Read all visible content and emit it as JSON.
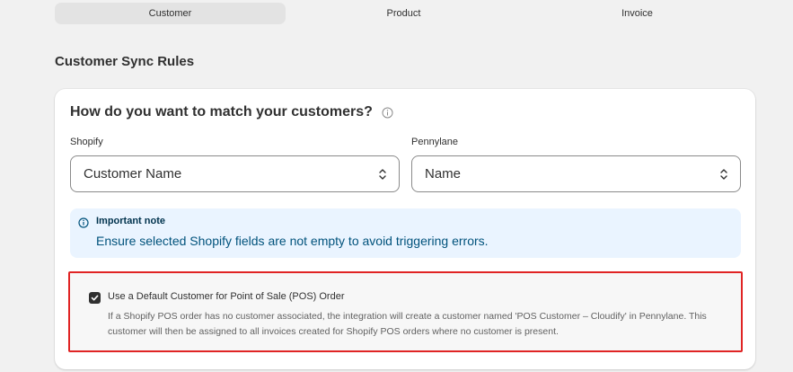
{
  "tabs": [
    {
      "label": "Customer",
      "active": true
    },
    {
      "label": "Product",
      "active": false
    },
    {
      "label": "Invoice",
      "active": false
    }
  ],
  "section_title": "Customer Sync Rules",
  "card": {
    "heading": "How do you want to match your customers?",
    "heading_icon": "info-icon",
    "shopify_label": "Shopify",
    "shopify_value": "Customer Name",
    "pennylane_label": "Pennylane",
    "pennylane_value": "Name",
    "select_icon": "chevron-up-down-icon"
  },
  "banner": {
    "icon": "info-icon",
    "title": "Important note",
    "text": "Ensure selected Shopify fields are not empty to avoid triggering errors.",
    "background": "#eaf4ff"
  },
  "pos_option": {
    "checked": true,
    "label": "Use a Default Customer for Point of Sale (POS) Order",
    "description": "If a Shopify POS order has no customer associated, the integration will create a customer named 'POS Customer – Cloudify' in Pennylane. This customer will then be assigned to all invoices created for Shopify POS orders where no customer is present.",
    "highlight_color": "#e02424"
  }
}
